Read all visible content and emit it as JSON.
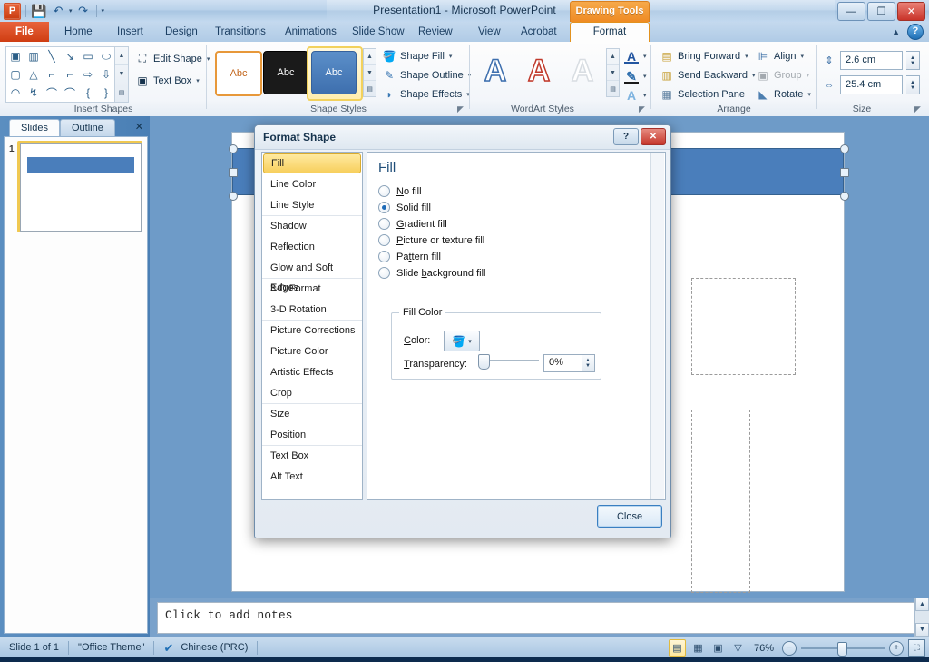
{
  "window": {
    "title": "Presentation1  -  Microsoft PowerPoint",
    "minimize": "—",
    "maximize": "❐",
    "close": "✕",
    "contextual_tab_group": "Drawing Tools",
    "collapse_ribbon_icon": "collapse-ribbon-icon",
    "help_label": "?"
  },
  "qat": {
    "app_logo": "P",
    "save_icon": "💾",
    "undo_icon": "↶",
    "undo_caret": "▾",
    "redo_icon": "↷",
    "customize_caret": "▾"
  },
  "tabs": [
    {
      "label": "File",
      "state": "file"
    },
    {
      "label": "Home",
      "state": "normal"
    },
    {
      "label": "Insert",
      "state": "normal"
    },
    {
      "label": "Design",
      "state": "normal"
    },
    {
      "label": "Transitions",
      "state": "normal"
    },
    {
      "label": "Animations",
      "state": "normal"
    },
    {
      "label": "Slide Show",
      "state": "normal"
    },
    {
      "label": "Review",
      "state": "normal"
    },
    {
      "label": "View",
      "state": "normal"
    },
    {
      "label": "Acrobat",
      "state": "normal"
    },
    {
      "label": "Format",
      "state": "active"
    }
  ],
  "ribbon": {
    "groups": [
      {
        "name": "Insert Shapes",
        "label": "Insert Shapes"
      },
      {
        "name": "Shape Styles",
        "label": "Shape Styles"
      },
      {
        "name": "WordArt Styles",
        "label": "WordArt Styles"
      },
      {
        "name": "Arrange",
        "label": "Arrange"
      },
      {
        "name": "Size",
        "label": "Size"
      }
    ],
    "insert_shapes": {
      "glyphs": [
        "▣",
        "▥",
        "╲",
        "↘",
        "▭",
        "⬭",
        "▢",
        "△",
        "⌐",
        "⌐",
        "⇨",
        "⇩",
        "◠",
        "↯",
        "⌒",
        "⌒",
        "{",
        "}"
      ],
      "scroll_up": "▲",
      "scroll_down": "▼",
      "scroll_more": "▤",
      "edit_shape": "Edit Shape",
      "text_box": "Text Box",
      "caret": "▾"
    },
    "shape_styles": {
      "swatches": [
        {
          "text": "Abc",
          "style": "white-outline-orange"
        },
        {
          "text": "Abc",
          "style": "black-fill"
        },
        {
          "text": "Abc",
          "style": "blue-fill-selected"
        }
      ],
      "shape_fill": "Shape Fill",
      "shape_outline": "Shape Outline",
      "shape_effects": "Shape Effects",
      "caret": "▾",
      "dialog_launcher": "◤"
    },
    "wordart_styles": {
      "swatches": [
        "A",
        "A",
        "A"
      ],
      "text_fill_icon": "A",
      "text_outline_icon": "✎",
      "text_effects_icon": "A",
      "caret": "▾",
      "dialog_launcher": "◤"
    },
    "arrange": {
      "bring_forward": "Bring Forward",
      "send_backward": "Send Backward",
      "selection_pane": "Selection Pane",
      "align": "Align",
      "group": "Group",
      "rotate": "Rotate",
      "caret": "▾"
    },
    "size": {
      "height_label": "shape-height",
      "height_value": "2.6 cm",
      "width_label": "shape-width",
      "width_value": "25.4 cm",
      "spin_up": "▲",
      "spin_down": "▼",
      "dialog_launcher": "◤"
    }
  },
  "left_pane": {
    "tab_slides": "Slides",
    "tab_outline": "Outline",
    "close": "✕",
    "slide_number": "1"
  },
  "notes": {
    "placeholder": "Click to add notes",
    "scroll_up": "▲",
    "scroll_down": "▼"
  },
  "statusbar": {
    "slide_count": "Slide 1 of 1",
    "theme": "\"Office Theme\"",
    "spellcheck_icon": "spellcheck-icon",
    "language": "Chinese (PRC)",
    "views": [
      {
        "name": "normal-view",
        "glyph": "▤",
        "selected": true
      },
      {
        "name": "slide-sorter-view",
        "glyph": "▦",
        "selected": false
      },
      {
        "name": "reading-view",
        "glyph": "▣",
        "selected": false
      },
      {
        "name": "slide-show-view",
        "glyph": "▽",
        "selected": false
      }
    ],
    "zoom_level": "76%",
    "zoom_out": "−",
    "zoom_in": "+",
    "fit_to_window": "⛶"
  },
  "dialog": {
    "title": "Format Shape",
    "help_button": "?",
    "close_button": "✕",
    "categories": [
      {
        "label": "Fill",
        "selected": true,
        "group_end": false
      },
      {
        "label": "Line Color",
        "selected": false,
        "group_end": false
      },
      {
        "label": "Line Style",
        "selected": false,
        "group_end": true
      },
      {
        "label": "Shadow",
        "selected": false,
        "group_end": false
      },
      {
        "label": "Reflection",
        "selected": false,
        "group_end": false
      },
      {
        "label": "Glow and Soft Edges",
        "selected": false,
        "group_end": true
      },
      {
        "label": "3-D Format",
        "selected": false,
        "group_end": false
      },
      {
        "label": "3-D Rotation",
        "selected": false,
        "group_end": true
      },
      {
        "label": "Picture Corrections",
        "selected": false,
        "group_end": false
      },
      {
        "label": "Picture Color",
        "selected": false,
        "group_end": false
      },
      {
        "label": "Artistic Effects",
        "selected": false,
        "group_end": false
      },
      {
        "label": "Crop",
        "selected": false,
        "group_end": true
      },
      {
        "label": "Size",
        "selected": false,
        "group_end": false
      },
      {
        "label": "Position",
        "selected": false,
        "group_end": true
      },
      {
        "label": "Text Box",
        "selected": false,
        "group_end": false
      },
      {
        "label": "Alt Text",
        "selected": false,
        "group_end": false
      }
    ],
    "pane_heading": "Fill",
    "fill_options": [
      {
        "label_pre": "",
        "label_key": "N",
        "label_post": "o fill",
        "selected": false
      },
      {
        "label_pre": "",
        "label_key": "S",
        "label_post": "olid fill",
        "selected": true
      },
      {
        "label_pre": "",
        "label_key": "G",
        "label_post": "radient fill",
        "selected": false
      },
      {
        "label_pre": "",
        "label_key": "P",
        "label_post": "icture or texture fill",
        "selected": false
      },
      {
        "label_pre": "Pa",
        "label_key": "t",
        "label_post": "tern fill",
        "selected": false
      },
      {
        "label_pre": "Slide ",
        "label_key": "b",
        "label_post": "ackground fill",
        "selected": false
      }
    ],
    "fill_color_group": {
      "legend": "Fill Color",
      "color_label_pre": "",
      "color_label_key": "C",
      "color_label_post": "olor:",
      "color_button_icon": "fill-bucket-icon",
      "color_caret": "▾",
      "transparency_label_pre": "",
      "transparency_label_key": "T",
      "transparency_label_post": "ransparency:",
      "transparency_value": "0%",
      "spin_up": "▲",
      "spin_down": "▼"
    },
    "close_label": "Close"
  }
}
